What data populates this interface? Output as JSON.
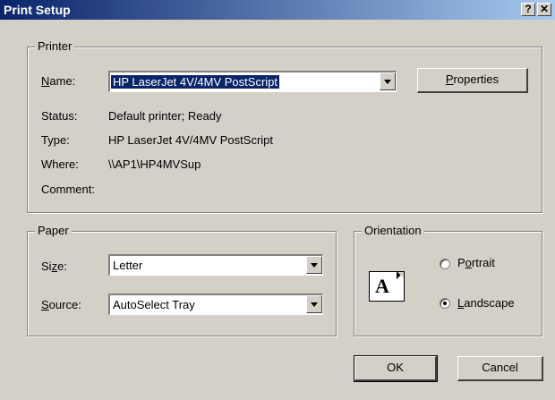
{
  "window": {
    "title": "Print Setup",
    "help_btn": "?",
    "close_btn": "✕"
  },
  "printer_group": {
    "label": "Printer",
    "name_label": "Name:",
    "name_value": "HP LaserJet 4V/4MV PostScript",
    "properties_button": "Properties",
    "status_label": "Status:",
    "status_value": "Default printer; Ready",
    "type_label": "Type:",
    "type_value": "HP LaserJet 4V/4MV PostScript",
    "where_label": "Where:",
    "where_value": "\\\\AP1\\HP4MVSup",
    "comment_label": "Comment:",
    "comment_value": ""
  },
  "paper_group": {
    "label": "Paper",
    "size_label": "Size:",
    "size_value": "Letter",
    "source_label": "Source:",
    "source_value": "AutoSelect Tray"
  },
  "orientation_group": {
    "label": "Orientation",
    "icon_letter": "A",
    "portrait_label": "Portrait",
    "landscape_label": "Landscape",
    "selected": "Landscape"
  },
  "buttons": {
    "ok": "OK",
    "cancel": "Cancel"
  }
}
